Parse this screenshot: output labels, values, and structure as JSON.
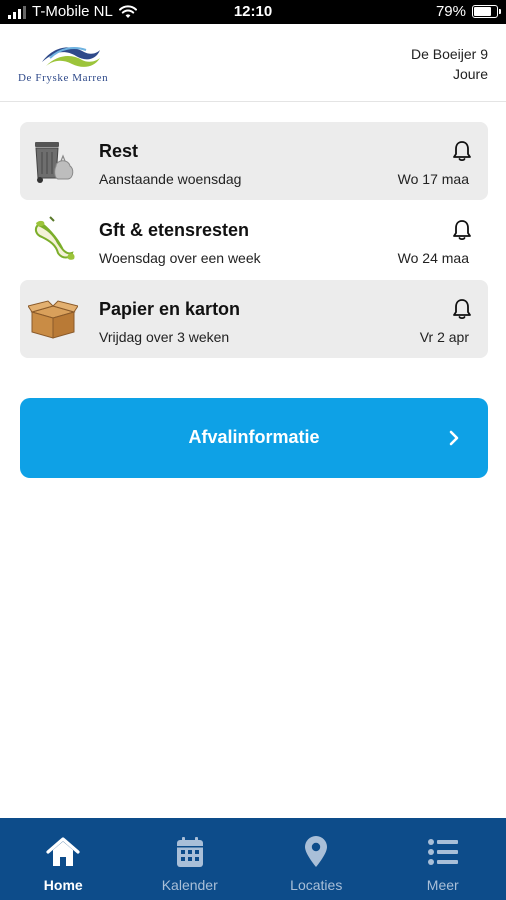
{
  "status_bar": {
    "carrier": "T-Mobile NL",
    "time": "12:10",
    "battery_percent": "79%",
    "battery_level": 0.79
  },
  "header": {
    "logo_text": "De Fryske Marren",
    "address_line1": "De Boeijer 9",
    "address_line2": "Joure"
  },
  "waste_items": [
    {
      "title": "Rest",
      "subtitle": "Aanstaande woensdag",
      "date": "Wo 17 maa",
      "icon": "grey-bin-icon",
      "shaded": true
    },
    {
      "title": "Gft & etensresten",
      "subtitle": "Woensdag over een week",
      "date": "Wo 24 maa",
      "icon": "apple-core-icon",
      "shaded": false
    },
    {
      "title": "Papier en karton",
      "subtitle": "Vrijdag over 3 weken",
      "date": "Vr 2 apr",
      "icon": "cardboard-box-icon",
      "shaded": true
    }
  ],
  "info_button": {
    "label": "Afvalinformatie"
  },
  "tabs": [
    {
      "label": "Home",
      "icon": "home-icon",
      "active": true
    },
    {
      "label": "Kalender",
      "icon": "calendar-icon",
      "active": false
    },
    {
      "label": "Locaties",
      "icon": "location-pin-icon",
      "active": false
    },
    {
      "label": "Meer",
      "icon": "list-icon",
      "active": false
    }
  ],
  "colors": {
    "accent_blue": "#0ea1e6",
    "tabbar_blue": "#0d4c8a",
    "card_grey": "#ececec"
  }
}
